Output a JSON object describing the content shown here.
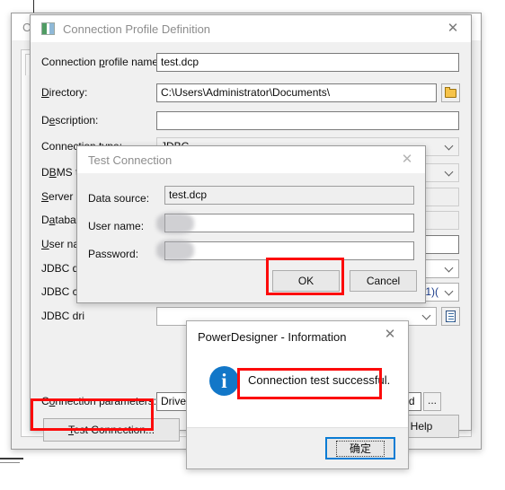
{
  "background_window": {
    "title": "Co",
    "tab_label": "O",
    "close_icon": "close-icon"
  },
  "caret": "text-caret",
  "connection_profile_dialog": {
    "title": "Connection Profile Definition",
    "app_icon": "profile-icon",
    "close_icon": "close-icon",
    "fields": [
      {
        "label_pre": "Connection ",
        "label_key": "p",
        "label_post": "rofile name:",
        "value": "test.dcp",
        "type": "text"
      },
      {
        "label_pre": "",
        "label_key": "D",
        "label_post": "irectory:",
        "value": "C:\\Users\\Administrator\\Documents\\",
        "type": "text-browse"
      },
      {
        "label_pre": "D",
        "label_key": "e",
        "label_post": "scription:",
        "value": "",
        "type": "text"
      },
      {
        "label_pre": "Connection type:",
        "label_key": "",
        "label_post": "",
        "value": "JDBC",
        "type": "combo-readonly"
      },
      {
        "label_pre": "D",
        "label_key": "B",
        "label_post": "MS ty",
        "value": "",
        "type": "combo-readonly"
      },
      {
        "label_pre": "",
        "label_key": "S",
        "label_post": "erver n",
        "value": "",
        "type": "text"
      },
      {
        "label_pre": "D",
        "label_key": "a",
        "label_post": "tabas",
        "value": "",
        "type": "text"
      },
      {
        "label_pre": "",
        "label_key": "U",
        "label_post": "ser nam",
        "value": "",
        "type": "text"
      },
      {
        "label_pre": "JDBC dri",
        "label_key": "",
        "label_post": "",
        "value": "",
        "type": "combo"
      },
      {
        "label_pre": "JDBC co",
        "label_key": "",
        "label_post": "",
        "value": "21)(",
        "type": "combo"
      },
      {
        "label_pre": "JDBC dri",
        "label_key": "",
        "label_post": "",
        "value": "",
        "type": "combo-doc"
      }
    ],
    "connection_parameters": {
      "label_pre": "C",
      "label_key": "o",
      "label_post": "nnection parameters:",
      "value_left": "Driver",
      "value_right": "in:@(d",
      "ellipsis_label": "..."
    },
    "test_connection_button": "Test Connection...",
    "test_connection_accesskey": "T",
    "help_button": "Help",
    "folder_icon": "folder-icon",
    "document_icon": "document-icon"
  },
  "test_connection_dialog": {
    "title": "Test Connection",
    "close_icon": "close-icon",
    "data_source_label": "Data source:",
    "data_source_value": "test.dcp",
    "user_name_label": "User name:",
    "user_name_value": "",
    "password_label": "Password:",
    "password_value": "",
    "ok_button": "OK",
    "cancel_button": "Cancel"
  },
  "information_dialog": {
    "title": "PowerDesigner - Information",
    "close_icon": "close-icon",
    "info_icon": "info-icon",
    "info_glyph": "i",
    "message": "Connection test successful.",
    "ok_button": "确定"
  },
  "annotations": {
    "color": "#fc0b0b",
    "boxes": [
      "test-connection-button-highlight",
      "ok-button-highlight",
      "success-message-highlight"
    ]
  }
}
